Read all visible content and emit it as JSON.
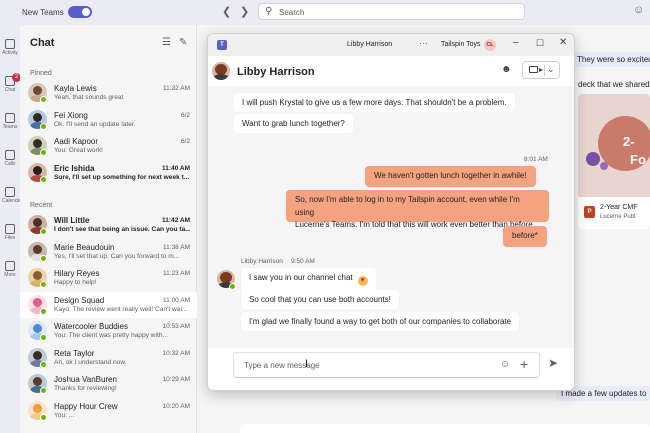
{
  "topbar": {
    "toggle_label": "New Teams",
    "search_placeholder": "Search",
    "back_icon": "chevron-left-icon",
    "forward_icon": "chevron-right-icon"
  },
  "rail": [
    {
      "label": "Activity",
      "badge": ""
    },
    {
      "label": "Chat",
      "badge": "2"
    },
    {
      "label": "Teams",
      "badge": ""
    },
    {
      "label": "Calls",
      "badge": ""
    },
    {
      "label": "Calendar",
      "badge": ""
    },
    {
      "label": "Files",
      "badge": ""
    },
    {
      "label": "More",
      "badge": ""
    }
  ],
  "chatlist": {
    "title": "Chat",
    "pinned_label": "Pinned",
    "recent_label": "Recent",
    "pinned": [
      {
        "name": "Kayla Lewis",
        "preview": "Yeah, that sounds great",
        "time": "11:32 AM",
        "unread": false,
        "head": "#6b4a3a",
        "body": "#c9a98f",
        "bg": "#d9c6b4"
      },
      {
        "name": "Fei Xiong",
        "preview": "Ok. I'll send an update later.",
        "time": "6/2",
        "unread": false,
        "head": "#2d2b2a",
        "body": "#4a6fa5",
        "bg": "#b8c7d9"
      },
      {
        "name": "Aadi Kapoor",
        "preview": "You: Great work!",
        "time": "6/2",
        "unread": false,
        "head": "#3b2a22",
        "body": "#7d8c6a",
        "bg": "#c9d3b5"
      },
      {
        "name": "Eric Ishida",
        "preview": "Sure, I'll set up something for next week t...",
        "time": "11:40 AM",
        "unread": true,
        "head": "#2a2220",
        "body": "#b04a3a",
        "bg": "#d8b9a8"
      }
    ],
    "recent": [
      {
        "name": "Will Little",
        "preview": "I don't see that being an issue. Can you ta...",
        "time": "11:42 AM",
        "unread": true,
        "head": "#4a3024",
        "body": "#8a3b2a",
        "bg": "#d0b0a0"
      },
      {
        "name": "Marie Beaudouin",
        "preview": "Yes, I'll set that up. Can you forward to m...",
        "time": "11:38 AM",
        "unread": false,
        "head": "#5a3a2a",
        "body": "#e8e0d8",
        "bg": "#c6b8ad"
      },
      {
        "name": "Hilary Reyes",
        "preview": "Happy to help!",
        "time": "11:23 AM",
        "unread": false,
        "head": "#8a5a30",
        "body": "#d9b26a",
        "bg": "#e8d5a8"
      },
      {
        "name": "Design Squad",
        "preview": "Kayo: The review went really well! Can't wai...",
        "time": "11:00 AM",
        "unread": false,
        "head": "#e85a8a",
        "body": "#f5b6c9",
        "bg": "#fde0ea"
      },
      {
        "name": "Watercooler Buddies",
        "preview": "You: The client was pretty happy with...",
        "time": "10:53 AM",
        "unread": false,
        "head": "#4f8bd0",
        "body": "#a5c8ef",
        "bg": "#dbe9f9"
      },
      {
        "name": "Reta Taylor",
        "preview": "Ah, ok I understand now.",
        "time": "10:32 AM",
        "unread": false,
        "head": "#3a2a24",
        "body": "#6a7da0",
        "bg": "#c0c8d9"
      },
      {
        "name": "Joshua VanBuren",
        "preview": "Thanks for reviewing!",
        "time": "10:29 AM",
        "unread": false,
        "head": "#5a3a28",
        "body": "#3f6f8f",
        "bg": "#b9cbd6"
      },
      {
        "name": "Happy Hour Crew",
        "preview": "You: ...",
        "time": "10:20 AM",
        "unread": false,
        "head": "#e8a040",
        "body": "#f5c98a",
        "bg": "#fbe4c4"
      }
    ]
  },
  "background": {
    "msg1": "They were so excited",
    "text1": "deck that we shared:",
    "card_big": "2-",
    "card_big2": "Fo",
    "file_name": "2-Year CMF",
    "file_sub": "Lucerne Publ",
    "msg2": "I made a few updates to"
  },
  "popout": {
    "window_title": "Libby Harrison",
    "org_name": "Tailspin Toys",
    "org_initials": "CL",
    "contact_name": "Libby Harrison",
    "messages_in_top": [
      "I will push Krystal to give us a few more days. That shouldn't be a problem.",
      "Want to grab lunch together?"
    ],
    "outgoing_time": "8:01 AM",
    "messages_out": [
      "We haven't gotten lunch together in awhile!",
      "So, now I'm able to log in to my Tailspin account, even while I'm using",
      "Lucerne's Teams. I'm told that this will work even better than before.",
      "before*"
    ],
    "sender_stamp": "Libby Harrison",
    "sender_time": "9:50 AM",
    "messages_in_bottom": [
      "I saw you in our channel chat",
      "So cool that you can use both accounts!",
      "I'm glad we finally found a way to get both of our companies to collaborate"
    ],
    "compose_placeholder": "Type a new message"
  }
}
